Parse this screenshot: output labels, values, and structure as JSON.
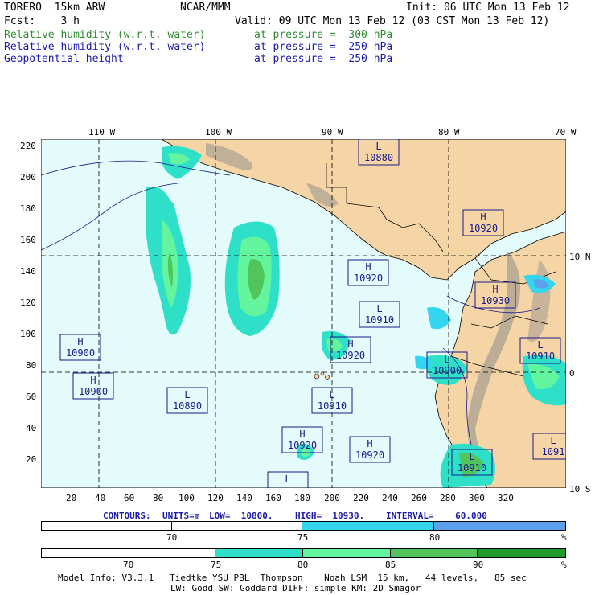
{
  "header": {
    "model": "TORERO  15km ARW",
    "org": "NCAR/MMM",
    "init": "Init: 06 UTC Mon 13 Feb 12",
    "fcst": "Fcst:    3 h",
    "valid": "Valid: 09 UTC Mon 13 Feb 12 (03 CST Mon 13 Feb 12)",
    "fields": [
      {
        "name": "Relative humidity (w.r.t. water)",
        "level": "at pressure =  300 hPa",
        "color": "#2e8b2e"
      },
      {
        "name": "Relative humidity (w.r.t. water)",
        "level": "at pressure =  250 hPa",
        "color": "#1a1aa8"
      },
      {
        "name": "Geopotential height",
        "level": "at pressure =  250 hPa",
        "color": "#1a1aa8"
      }
    ]
  },
  "map": {
    "top_lon_labels": [
      "110 W",
      "100 W",
      "90 W",
      "80 W",
      "70 W"
    ],
    "left_ticks": [
      "220",
      "200",
      "180",
      "160",
      "140",
      "120",
      "100",
      "80",
      "60",
      "40",
      "20"
    ],
    "bottom_ticks": [
      "20",
      "40",
      "60",
      "80",
      "100",
      "120",
      "140",
      "160",
      "180",
      "200",
      "220",
      "240",
      "260",
      "280",
      "300",
      "320"
    ],
    "right_lat_labels": [
      "10 N",
      "0",
      "10 S"
    ],
    "colors": {
      "ocean": "#e4fbfb",
      "land": "#f5d5a6",
      "mountain": "#a89f92",
      "grid": "#000000",
      "box": "#1a1a8a"
    },
    "centers": [
      {
        "sym": "L",
        "val": "10880"
      },
      {
        "sym": "H",
        "val": "10920"
      },
      {
        "sym": "H",
        "val": "10920"
      },
      {
        "sym": "H",
        "val": "10930"
      },
      {
        "sym": "L",
        "val": "10910"
      },
      {
        "sym": "H",
        "val": "10900"
      },
      {
        "sym": "H",
        "val": "10920"
      },
      {
        "sym": "L",
        "val": "10900"
      },
      {
        "sym": "L",
        "val": "10910"
      },
      {
        "sym": "H",
        "val": "10900"
      },
      {
        "sym": "L",
        "val": "10890"
      },
      {
        "sym": "L",
        "val": "10910"
      },
      {
        "sym": "H",
        "val": "10920"
      },
      {
        "sym": "H",
        "val": "10920"
      },
      {
        "sym": "L",
        "val": "10910"
      },
      {
        "sym": "L",
        "val": "1091"
      },
      {
        "sym": "L",
        "val": ""
      }
    ]
  },
  "contours": {
    "label": "CONTOURS:",
    "units": "UNITS=m",
    "low": "LOW=  10800.",
    "high": "HIGH=  10930.",
    "interval": "INTERVAL=    60.000"
  },
  "colorbar1": {
    "labels": [
      "70",
      "75",
      "80",
      "%"
    ],
    "colors": [
      "#ffffff",
      "#ffffff",
      "#33d6ee",
      "#5aa0ea"
    ]
  },
  "colorbar2": {
    "labels": [
      "70",
      "75",
      "80",
      "85",
      "90",
      "%"
    ],
    "colors": [
      "#ffffff",
      "#ffffff",
      "#2ee0c8",
      "#63f59d",
      "#52c45c",
      "#1f9a2b"
    ]
  },
  "footer": {
    "line1": "Model Info: V3.3.1   Tiedtke YSU PBL  Thompson    Noah LSM  15 km,   44 levels,   85 sec",
    "line2": "LW: Godd SW: Goddard DIFF: simple KM: 2D Smagor"
  }
}
